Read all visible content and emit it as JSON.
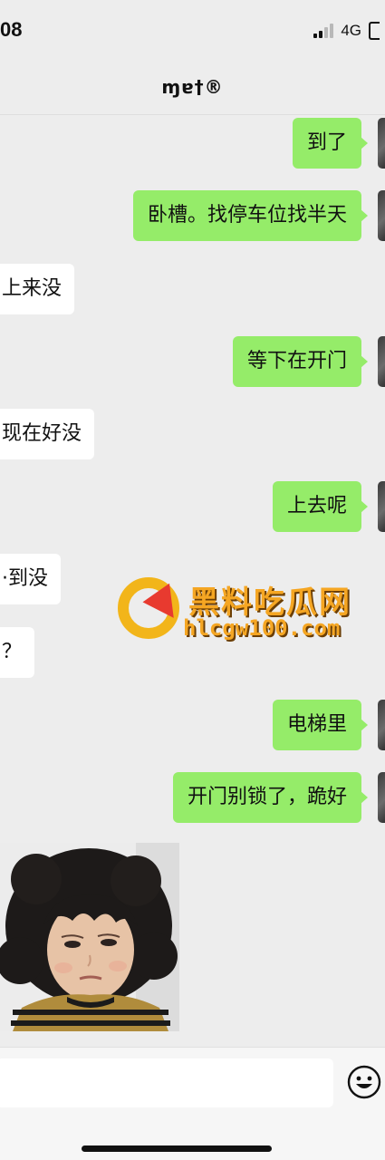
{
  "status_bar": {
    "time": "08",
    "network": "4G"
  },
  "header": {
    "title": "ɱɐ†®"
  },
  "messages": [
    {
      "side": "out",
      "text": "到了"
    },
    {
      "side": "out",
      "text": "卧槽。找停车位找半天"
    },
    {
      "side": "in",
      "text": "上来没"
    },
    {
      "side": "out",
      "text": "等下在开门"
    },
    {
      "side": "in",
      "text": "现在好没"
    },
    {
      "side": "out",
      "text": "上去呢"
    },
    {
      "side": "in",
      "text": "·到没"
    },
    {
      "side": "in",
      "text": "？"
    },
    {
      "side": "out",
      "text": "电梯里"
    },
    {
      "side": "out",
      "text": "开门别锁了，跪好"
    }
  ],
  "watermark": {
    "title": "黑料吃瓜网",
    "url": "hlcgw100.com"
  },
  "input_bar": {
    "placeholder": "",
    "emoji_icon": "smiley-face-icon"
  },
  "colors": {
    "outgoing_bubble": "#95ec69",
    "incoming_bubble": "#ffffff",
    "background": "#ededed",
    "watermark": "#f5a623"
  }
}
